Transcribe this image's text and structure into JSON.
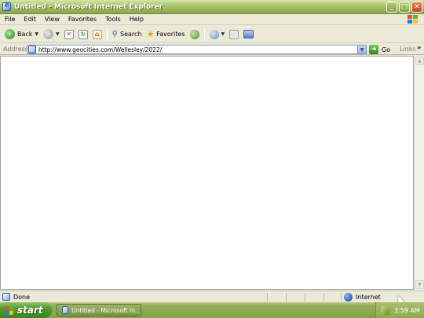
{
  "window": {
    "title": "Untitled - Microsoft Internet Explorer",
    "controls": {
      "minimize": "_",
      "maximize": "□",
      "close": "✕"
    }
  },
  "menu": [
    "File",
    "Edit",
    "View",
    "Favorites",
    "Tools",
    "Help"
  ],
  "toolbar": {
    "back_label": "Back",
    "search_label": "Search",
    "favorites_label": "Favorites",
    "icons": [
      "back-icon",
      "forward-icon",
      "stop-icon",
      "refresh-icon",
      "home-icon",
      "search-icon",
      "favorites-icon",
      "media-icon",
      "mail-icon",
      "print-icon",
      "edit-icon"
    ]
  },
  "address": {
    "label": "Address",
    "url": "http://www.geocities.com/Wellesley/2022/",
    "go_label": "Go",
    "links_label": "Links"
  },
  "status": {
    "text": "Done",
    "zone": "Internet"
  },
  "taskbar": {
    "start_label": "start",
    "task_label": "Untitled - Microsoft In...",
    "clock": "3:59 AM"
  },
  "colors": {
    "title_bar": "#8ba74a",
    "taskbar": "#85a048",
    "start_button": "#4f9a2a",
    "close_button": "#c2421e"
  }
}
